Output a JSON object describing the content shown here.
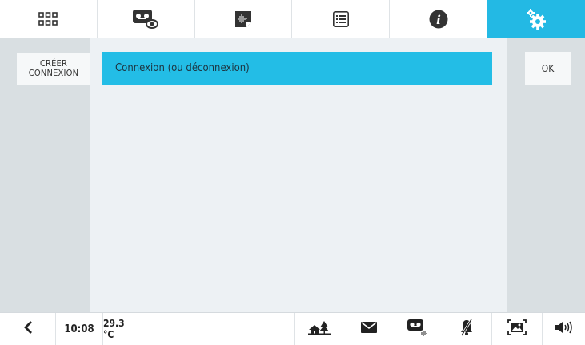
{
  "tabs": [
    {
      "icon": "grid-icon",
      "active": false
    },
    {
      "icon": "tape-view-icon",
      "active": false
    },
    {
      "icon": "voice-memo-icon",
      "active": false
    },
    {
      "icon": "list-icon",
      "active": false
    },
    {
      "icon": "info-icon",
      "active": false
    },
    {
      "icon": "gears-icon",
      "active": true
    }
  ],
  "left": {
    "create_line1": "CRÉER",
    "create_line2": "CONNEXION"
  },
  "main": {
    "items": [
      {
        "label": "Connexion (ou déconnexion)",
        "selected": true
      }
    ]
  },
  "right": {
    "ok_label": "OK"
  },
  "bottom": {
    "time": "10:08",
    "temperature": "29.3 °C",
    "icons": [
      "back-arrow-icon",
      "home-icon",
      "mail-icon",
      "tape-audio-icon",
      "bell-off-icon",
      "picture-frame-icon",
      "speaker-icon"
    ]
  },
  "colors": {
    "accent": "#23b9e4",
    "panel": "#d9dfe2",
    "main_bg": "#edf1f4"
  }
}
